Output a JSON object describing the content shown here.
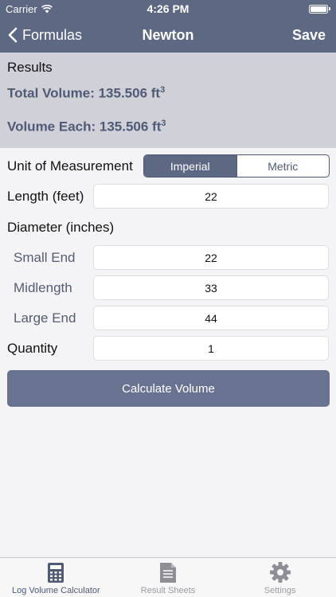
{
  "status_bar": {
    "carrier": "Carrier",
    "time": "4:26 PM"
  },
  "nav": {
    "back_label": "Formulas",
    "title": "Newton",
    "save_label": "Save"
  },
  "results": {
    "heading": "Results",
    "total_label": "Total Volume: 135.506 ft",
    "each_label": "Volume Each: 135.506 ft",
    "unit_superscript": "3"
  },
  "unit": {
    "label": "Unit of Measurement",
    "options": [
      "Imperial",
      "Metric"
    ],
    "selected": "Imperial"
  },
  "length": {
    "label": "Length (feet)",
    "value": "22"
  },
  "diameter": {
    "label": "Diameter (inches)",
    "small_end": {
      "label": "Small End",
      "value": "22"
    },
    "midlength": {
      "label": "Midlength",
      "value": "33"
    },
    "large_end": {
      "label": "Large End",
      "value": "44"
    }
  },
  "quantity": {
    "label": "Quantity",
    "value": "1"
  },
  "calculate_label": "Calculate Volume",
  "tabs": [
    {
      "label": "Log Volume Calculator",
      "icon": "calculator-icon",
      "active": true
    },
    {
      "label": "Result Sheets",
      "icon": "document-icon",
      "active": false
    },
    {
      "label": "Settings",
      "icon": "gear-icon",
      "active": false
    }
  ],
  "colors": {
    "accent": "#5d6883",
    "results_bg": "#d0d0d8",
    "results_text": "#4f5a75",
    "button": "#687391"
  }
}
